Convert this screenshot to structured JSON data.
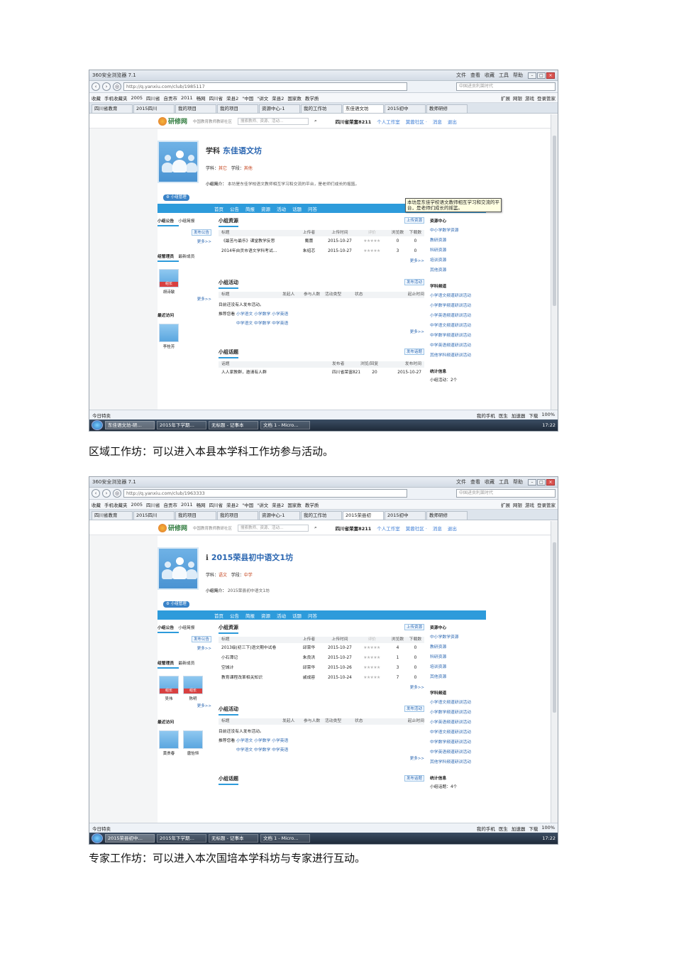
{
  "browser": {
    "title": "360安全浏览器 7.1",
    "menus": [
      "文件",
      "查看",
      "收藏",
      "工具",
      "帮助"
    ],
    "search_placeholder": "中国进贡利莱时代",
    "favorites": [
      "收藏",
      "手机收藏夹",
      "2005",
      "四川省",
      "自贡市",
      "2011",
      "畅网",
      "四川省",
      "荣县2",
      "\"中国",
      "\"讲文",
      "荣县2",
      "国家数",
      "教学质"
    ],
    "fav_right": [
      "扩展",
      "网银",
      "游戏",
      "登录管家"
    ],
    "status_left": "今日特卖",
    "status_right": [
      "我的手机",
      "医生",
      "加速器",
      "下载",
      "100%"
    ],
    "clock": "17:22"
  },
  "site": {
    "logo": "研修网",
    "slogan": "中国教育教师教研社区",
    "search_placeholder": "搜索教师、资源、活动…",
    "user": "四川省荣富8211",
    "links": [
      "个人工作室",
      "莫蓉社区 ·",
      "消息",
      "退出"
    ],
    "nav": [
      "首页",
      "公告",
      "简报",
      "资源",
      "活动",
      "话题",
      "问答"
    ]
  },
  "labels": {
    "subject": "学科：",
    "stage": "学段：",
    "intro": "小组简介：",
    "mgr_btn": "小组管理",
    "notice": "小组公告",
    "brief": "小组简报",
    "post_notice": "发布公告",
    "more": "更多>>",
    "team": "组管理员",
    "new_members": "最新成员",
    "leader_tag": "组长",
    "recent": "最近访问",
    "resources": "小组资源",
    "upload": "上传资源",
    "activities": "小组活动",
    "post_activity": "发布活动",
    "topics": "小组话题",
    "post_topic": "发布话题",
    "res_cols": [
      "标题",
      "上传者",
      "上传时间",
      "评价",
      "浏览数",
      "下载数"
    ],
    "act_cols": [
      "标题",
      "发起人",
      "参与人数",
      "活动类型",
      "状态",
      "起止时间"
    ],
    "no_activity": "目前还没有人发布活动。",
    "recommend": "推荐您看",
    "rec1": [
      "小学语文",
      "小学数学",
      "小学英语"
    ],
    "rec2": [
      "中学语文",
      "中学数学",
      "中学英语"
    ],
    "res_center": "资源中心",
    "res_links": [
      "中小学数学资源",
      "教研资源",
      "科研资源",
      "培训资源",
      "其他资源"
    ],
    "channels": "学科频道",
    "channel_links": [
      "小学语文频道研训活动",
      "小学数学频道研训活动",
      "小学英语频道研训活动",
      "中学语文频道研训活动",
      "中学数学频道研训活动",
      "中学英语频道研训活动",
      "其他学科频道研训活动"
    ],
    "stats": "统计信息"
  },
  "shot1": {
    "address": "http://q.yanxiu.com/club/1985117",
    "tabs": [
      "四川省教育",
      "2015四川",
      "我的项目",
      "我的项目",
      "资源中心-1",
      "我的工作坊",
      "东佳语文坊",
      "2015初中",
      "教师研修"
    ],
    "title_glyph": "学科",
    "title": "东佳语文坊",
    "subject": "其它",
    "stage": "其他",
    "intro": "本坊是东佳学校语文教师相互学习和交流的平台，是老师们成长的摇篮。",
    "tooltip": "本坊是东佳学校语文教师相互学习和交流的平台，是老师们成长的摇篮。",
    "members": [
      {
        "name": "胡诗敏",
        "tag": true
      }
    ],
    "recent": [
      {
        "name": "李桂芳"
      }
    ],
    "resources": [
      [
        "《最苦与最乐》课堂教学反思",
        "戴蕾",
        "2015-10-27",
        "★★★★★",
        "0",
        "0"
      ],
      [
        "2014年自贡市语文学科考试…",
        "朱绍芯",
        "2015-10-27",
        "★★★★★",
        "3",
        "0"
      ]
    ],
    "topic_cols": [
      "话题",
      "发布者",
      "浏览/回复",
      "发布时间"
    ],
    "topic_row": [
      "人人家教群，邀请有人群",
      "四川省荣富8211",
      "20",
      "2015-10-27"
    ],
    "stat": "小组活动：2个",
    "task_buttons": [
      "东佳语文坊-研…",
      "2015年下学期…",
      "无标题 - 记事本",
      "文档 1 - Micro…"
    ]
  },
  "shot2": {
    "address": "http://q.yanxiu.com/club/1963333",
    "tabs": [
      "四川省教育",
      "2015四川",
      "我的项目",
      "我的项目",
      "资源中心-1",
      "我的工作坊",
      "2015荣县初",
      "2015初中",
      "教师研修"
    ],
    "title_glyph": "i",
    "title": "2015荣县初中语文1坊",
    "subject": "语文",
    "stage": "中学",
    "intro": "2015荣县初中语文1坊",
    "members": [
      {
        "name": "吴伟",
        "tag": true
      },
      {
        "name": "陈明",
        "tag": true
      }
    ],
    "recent": [
      {
        "name": "黄贵春"
      },
      {
        "name": "唐怡恒"
      }
    ],
    "resources": [
      [
        "2013级(初三下)语文期中试卷",
        "邱荣华",
        "2015-10-27",
        "★★★★★",
        "4",
        "0"
      ],
      [
        "小石潭记",
        "朱良洪",
        "2015-10-27",
        "★★★★★",
        "1",
        "0"
      ],
      [
        "空城计",
        "邱荣华",
        "2015-10-26",
        "★★★★★",
        "3",
        "0"
      ],
      [
        "教育课程改革相关知识",
        "戚成容",
        "2015-10-24",
        "★★★★★",
        "7",
        "0"
      ]
    ],
    "stat": "小组话题：4个",
    "task_buttons": [
      "2015荣县初中…",
      "2015年下学期…",
      "无标题 - 记事本",
      "文档 1 - Micro…"
    ]
  },
  "captions": [
    "区域工作坊：可以进入本县本学科工作坊参与活动。",
    "专家工作坊：可以进入本次国培本学科坊与专家进行互动。"
  ]
}
